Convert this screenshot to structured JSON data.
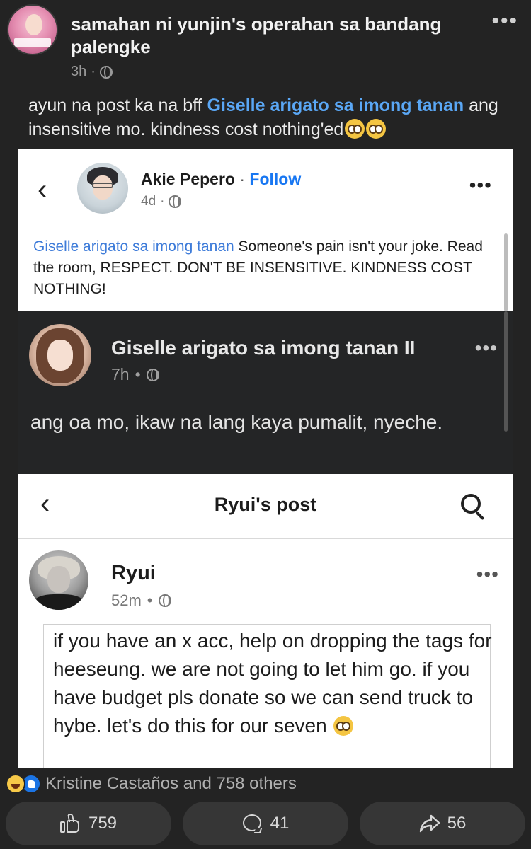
{
  "header": {
    "group_name": "samahan ni yunjin's operahan sa bandang palengke",
    "time": "3h",
    "more_label": "•••"
  },
  "caption": {
    "prefix": "ayun na post ka na bff ",
    "mention": "Giselle arigato sa imong tanan",
    "suffix": " ang insensitive mo. kindness cost nothing'ed"
  },
  "panel1": {
    "name": "Akie Pepero",
    "separator": " · ",
    "follow_label": "Follow",
    "time": "4d",
    "mention": "Giselle arigato sa imong tanan",
    "text": " Someone's pain isn't your joke. Read the room, RESPECT. DON'T BE INSENSITIVE. KINDNESS COST NOTHING!",
    "more_label": "•••",
    "back_label": "‹"
  },
  "panel2": {
    "name": "Giselle arigato sa imong tanan II",
    "time": "7h",
    "text": "ang oa mo, ikaw na lang kaya pumalit, nyeche.",
    "more_label": "•••"
  },
  "panel3": {
    "title": "Ryui's post",
    "back_label": "‹",
    "name": "Ryui",
    "time": "52m",
    "text": "if you have an x acc, help on dropping the tags for heeseung. we are not going to let him go. if you have budget pls donate so we can send truck to hybe. let's do this for our seven",
    "more_label": "•••"
  },
  "footer": {
    "reactions_text": "Kristine Castaños and 758 others",
    "like_count": "759",
    "comment_count": "41",
    "share_count": "56"
  },
  "colors": {
    "background": "#232323",
    "mention_blue": "#5aa7f5",
    "fb_blue": "#1877f2"
  }
}
